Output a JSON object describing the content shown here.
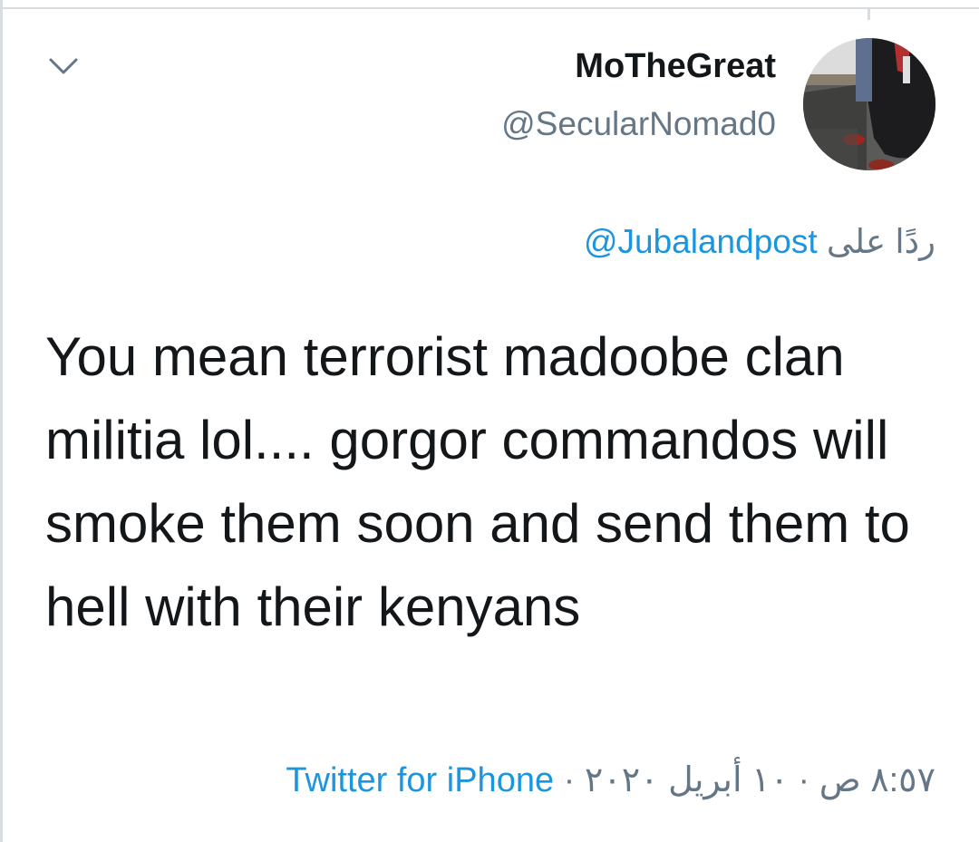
{
  "tweet": {
    "author": {
      "display_name": "MoTheGreat",
      "handle": "@SecularNomad0",
      "avatar_icon": "user-avatar-photo"
    },
    "reply_to": {
      "prefix": "ردًا على",
      "mention": "@Jubalandpost"
    },
    "text": "You mean terrorist madoobe clan militia lol.... gorgor commandos will smoke them soon and send them to hell with their kenyans",
    "meta": {
      "time": "٨:٥٧ ص",
      "date": "١٠ أبريل ٢٠٢٠",
      "separator": "·",
      "source": "Twitter for iPhone"
    }
  },
  "icons": {
    "menu_chevron": "chevron-down-icon"
  },
  "colors": {
    "text_primary": "#14171a",
    "text_secondary": "#657786",
    "link": "#1b95e0",
    "border": "#d7dce1"
  }
}
